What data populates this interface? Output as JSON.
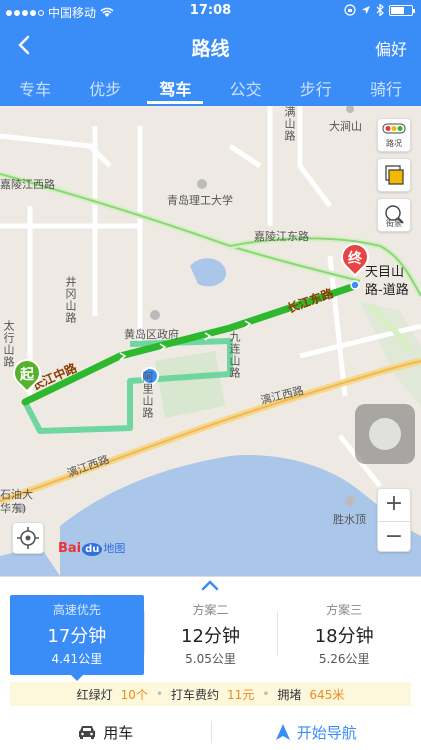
{
  "status_bar": {
    "carrier": "中国移动",
    "time": "17:08"
  },
  "header": {
    "title": "路线",
    "preference_label": "偏好"
  },
  "tabs": [
    {
      "label": "专车",
      "active": false
    },
    {
      "label": "优步",
      "active": false
    },
    {
      "label": "驾车",
      "active": true
    },
    {
      "label": "公交",
      "active": false
    },
    {
      "label": "步行",
      "active": false
    },
    {
      "label": "骑行",
      "active": false
    }
  ],
  "map": {
    "controls": {
      "traffic_label": "路况",
      "streetview_label": "街景"
    },
    "labels": {
      "dajian": "大涧山",
      "jialingjiang_west": "嘉陵江西路",
      "qingdao_univ": "青岛理工大学",
      "jialingjiang_east": "嘉陵江东路",
      "jinggangshan": "井冈山路",
      "huangdao_gov": "黄岛区政府",
      "changjiang_middle": "长江中路",
      "changjiang_east": "长江东路",
      "alishan": "阿里山路",
      "jiulianshan": "九连山路",
      "lijiang_west_upper": "漓江西路",
      "lijiang_west_lower": "漓江西路",
      "tianmushan": "天目山路-道路",
      "shengshuiding": "胜水顶",
      "shiyou": "石油大",
      "huadong": "华东)",
      "taihang": "太行山路",
      "top_road": "满山路"
    },
    "start_marker": "起",
    "end_marker": "终",
    "logo_text": "Bai",
    "logo_du": "du",
    "logo_map": "地图",
    "zoom_in": "+",
    "zoom_out": "−"
  },
  "plans": [
    {
      "name": "高速优先",
      "duration": "17分钟",
      "distance": "4.41公里",
      "active": true
    },
    {
      "name": "方案二",
      "duration": "12分钟",
      "distance": "5.05公里",
      "active": false
    },
    {
      "name": "方案三",
      "duration": "18分钟",
      "distance": "5.26公里",
      "active": false
    }
  ],
  "route_info": {
    "traffic_lights_label": "红绿灯",
    "traffic_lights_value": "10个",
    "taxi_fare_label": "打车费约",
    "taxi_fare_value": "11元",
    "congestion_label": "拥堵",
    "congestion_value": "645米"
  },
  "actions": {
    "car_label": "用车",
    "navigate_label": "开始导航"
  },
  "colors": {
    "brand_blue": "#3a8cf7",
    "route_green": "#2db82d",
    "alt_route": "#6fd6a0",
    "highlight_orange": "#f08a1b",
    "start_pin": "#58b02f",
    "end_pin": "#e64545"
  }
}
